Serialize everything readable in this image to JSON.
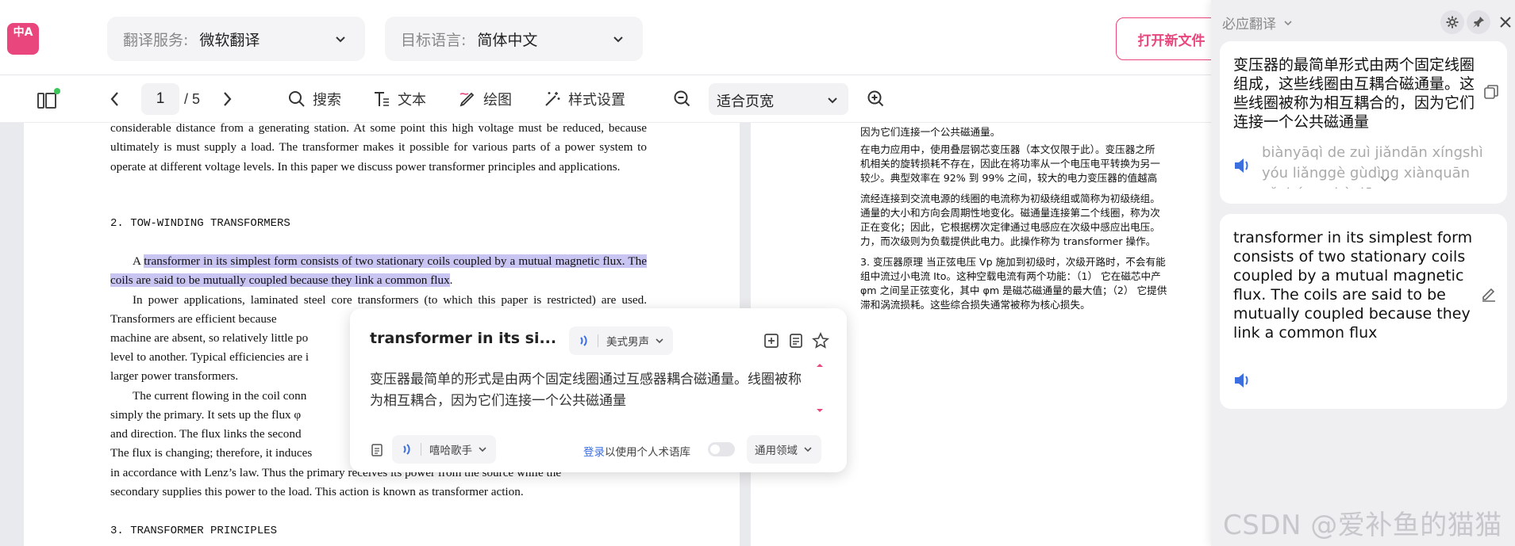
{
  "header": {
    "logo_text": "中A",
    "service": {
      "label": "翻译服务:",
      "value": "微软翻译"
    },
    "target_lang": {
      "label": "目标语言:",
      "value": "简体中文"
    },
    "open_file": "打开新文件"
  },
  "toolbar": {
    "page_current": "1",
    "page_total": "/ 5",
    "search": "搜索",
    "text": "文本",
    "draw": "绘图",
    "style": "样式设置",
    "zoom_value": "适合页宽"
  },
  "doc_en": {
    "p1": "considerable distance from a generating station. At some point this high voltage must be reduced, because ultimately is must supply a load. The transformer makes it possible for various parts of a power system to operate at different voltage levels. In this paper we discuss power transformer principles and applications.",
    "h2": "2. TOW-WINDING TRANSFORMERS",
    "p2_pre": "A ",
    "p2_hl": "transformer in its simplest form consists of two stationary coils coupled by a mutual magnetic flux. The coils are said to be mutually coupled because they link a common flux",
    "p2_post": ".",
    "p3": "In power applications, laminated steel core transformers (to which this paper is restricted) are used. Transformers are efficient because",
    "p3b": "machine are absent, so relatively little po",
    "p3c": "level to another. Typical efficiencies are i",
    "p3d": "larger power transformers.",
    "p4a": "The current flowing in the coil conn",
    "p4b": "simply the primary. It sets up the flux φ",
    "p4c": "and direction. The flux links the second",
    "p4d": "The flux is changing; therefore, it induces",
    "p4e": "in accordance with Lenz’s law. Thus the primary receives its power from the source while the",
    "p4f": "secondary supplies this power to the load. This action is known as transformer action.",
    "h3": "3. TRANSFORMER PRINCIPLES"
  },
  "doc_cn": {
    "l0": "因为它们连接一个公共磁通量。",
    "l1": "在电力应用中，使用叠层钢芯变压器（本文仅限于此）。变压器之所",
    "l2": "机相关的旋转损耗不存在，因此在将功率从一个电压电平转换为另一",
    "l3": "较少。典型效率在 92% 到 99% 之间，较大的电力变压器的值越高",
    "l4": "流经连接到交流电源的线圈的电流称为初级绕组或简称为初级绕组。",
    "l5": "通量的大小和方向会周期性地变化。磁通量连接第二个线圈，称为次",
    "l6": "正在变化；因此，它根据楞次定律通过电感应在次级中感应出电压。",
    "l7": "力，而次级则为负载提供此电力。此操作称为 transformer 操作。",
    "l8": "3. 变压器原理 当正弦电压 Vp 施加到初级时，次级开路时，不会有能",
    "l9": "组中流过小电流 Ito。这种空载电流有两个功能：（1） 它在磁芯中产",
    "l10": "φm 之间呈正弦变化，其中 φm 是磁芯磁通量的最大值；（2） 它提供",
    "l11": "滞和涡流损耗。这些综合损失通常被称为核心损失。"
  },
  "popup": {
    "title": "transformer in its si...",
    "voice_top": "美式男声",
    "translation": "变压器最简单的形式是由两个固定线圈通过互感器耦合磁通量。线圈被称为相互耦合，因为它们连接一个公共磁通量",
    "voice_bottom": "嘻哈歌手",
    "login_link": "登录",
    "login_rest": "以使用个人术语库",
    "domain": "通用领域"
  },
  "side": {
    "header": "必应翻译",
    "card1_text": "变压器的最简单形式由两个固定线圈组成，这些线圈由互耦合磁通量。这些线圈被称为相互耦合的，因为它们连接一个公共磁通量",
    "card1_pinyin": "biànyāqì de zuì jiǎndān xíngshì yóu liǎnggè gùdìng xiànquān zǔchéng zhèxiē",
    "card2_text": "transformer in its simplest form consists of two stationary coils coupled by a mutual magnetic flux. The coils are said to be mutually coupled because they link a common flux"
  },
  "watermark": "CSDN @爱补鱼的猫猫",
  "colors": {
    "accent": "#e8467c",
    "highlight": "#c9c5f2",
    "link": "#3b6fe0",
    "speaker": "#3b6fe0"
  }
}
